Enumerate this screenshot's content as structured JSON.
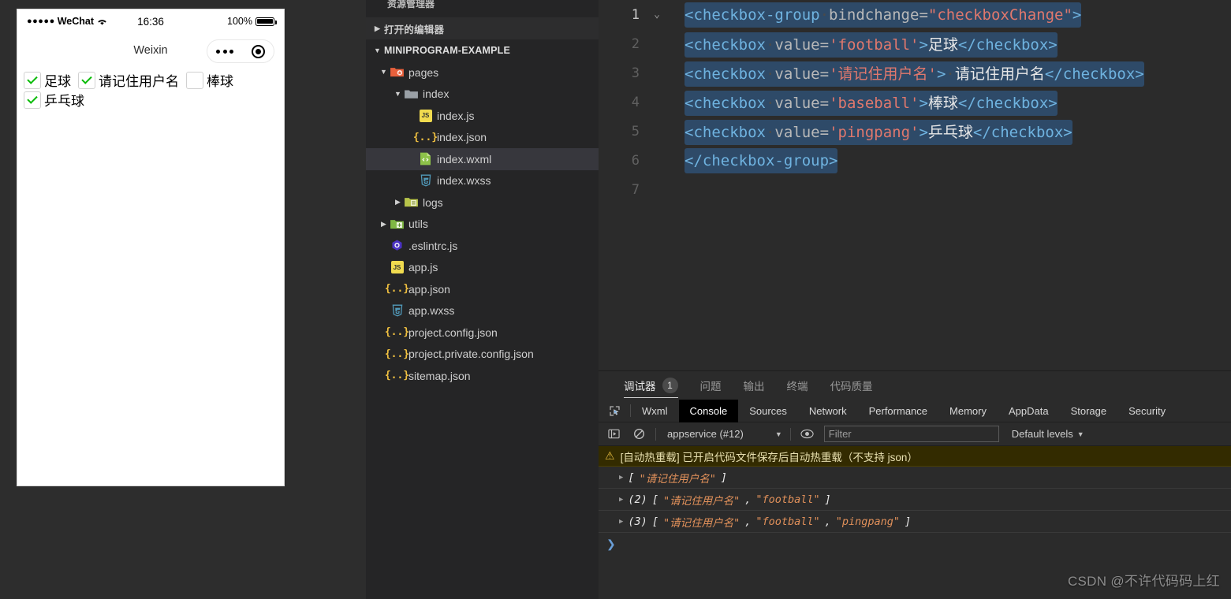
{
  "simulator": {
    "statusbar": {
      "carrier": "WeChat",
      "dots": "●●●●●",
      "wifi": "≈",
      "time": "16:36",
      "battery": "100%"
    },
    "navbar": {
      "title": "Weixin"
    },
    "checkboxes": [
      {
        "label": "足球",
        "checked": true
      },
      {
        "label": "请记住用户名",
        "checked": true
      },
      {
        "label": "棒球",
        "checked": false
      },
      {
        "label": "乒乓球",
        "checked": true
      }
    ]
  },
  "explorer": {
    "title": "资源管理器",
    "opened_editors": "打开的编辑器",
    "project": "MINIPROGRAM-EXAMPLE",
    "tree": [
      {
        "label": "pages",
        "type": "folder-pages",
        "depth": 1,
        "twisty": "▼"
      },
      {
        "label": "index",
        "type": "folder",
        "depth": 2,
        "twisty": "▼"
      },
      {
        "label": "index.js",
        "type": "js",
        "depth": 3,
        "twisty": ""
      },
      {
        "label": "index.json",
        "type": "json",
        "depth": 3,
        "twisty": ""
      },
      {
        "label": "index.wxml",
        "type": "wxml",
        "depth": 3,
        "twisty": "",
        "selected": true
      },
      {
        "label": "index.wxss",
        "type": "wxss",
        "depth": 3,
        "twisty": ""
      },
      {
        "label": "logs",
        "type": "folder-logs",
        "depth": 2,
        "twisty": "▶"
      },
      {
        "label": "utils",
        "type": "folder-utils",
        "depth": 1,
        "twisty": "▶"
      },
      {
        "label": ".eslintrc.js",
        "type": "eslint",
        "depth": 1,
        "twisty": ""
      },
      {
        "label": "app.js",
        "type": "js",
        "depth": 1,
        "twisty": ""
      },
      {
        "label": "app.json",
        "type": "json",
        "depth": 1,
        "twisty": ""
      },
      {
        "label": "app.wxss",
        "type": "wxss",
        "depth": 1,
        "twisty": ""
      },
      {
        "label": "project.config.json",
        "type": "json",
        "depth": 1,
        "twisty": ""
      },
      {
        "label": "project.private.config.json",
        "type": "json",
        "depth": 1,
        "twisty": ""
      },
      {
        "label": "sitemap.json",
        "type": "json",
        "depth": 1,
        "twisty": ""
      }
    ]
  },
  "editor": {
    "lines": [
      {
        "num": "1",
        "fold": "⌄",
        "active": true,
        "tokens": [
          {
            "t": "tag",
            "v": "<checkbox-group"
          },
          {
            "t": "dot",
            "v": "·"
          },
          {
            "t": "attr",
            "v": "bindchange"
          },
          {
            "t": "eq",
            "v": "="
          },
          {
            "t": "str",
            "v": "\"checkboxChange\""
          },
          {
            "t": "tag",
            "v": ">"
          }
        ]
      },
      {
        "num": "2",
        "fold": "",
        "tokens": [
          {
            "t": "tag",
            "v": "<checkbox"
          },
          {
            "t": "dot",
            "v": "·"
          },
          {
            "t": "attr",
            "v": "value"
          },
          {
            "t": "eq",
            "v": "="
          },
          {
            "t": "str",
            "v": "'football'"
          },
          {
            "t": "tag",
            "v": ">"
          },
          {
            "t": "txt",
            "v": "足球"
          },
          {
            "t": "tag",
            "v": "</checkbox>"
          }
        ]
      },
      {
        "num": "3",
        "fold": "",
        "tokens": [
          {
            "t": "tag",
            "v": "<checkbox"
          },
          {
            "t": "dot",
            "v": "·"
          },
          {
            "t": "attr",
            "v": "value"
          },
          {
            "t": "eq",
            "v": "="
          },
          {
            "t": "str",
            "v": "'请记住用户名'"
          },
          {
            "t": "tag",
            "v": ">"
          },
          {
            "t": "dot",
            "v": "·"
          },
          {
            "t": "txt",
            "v": "请记住用户名"
          },
          {
            "t": "tag",
            "v": "</checkbox>"
          }
        ]
      },
      {
        "num": "4",
        "fold": "",
        "tokens": [
          {
            "t": "tag",
            "v": "<checkbox"
          },
          {
            "t": "dot",
            "v": "·"
          },
          {
            "t": "attr",
            "v": "value"
          },
          {
            "t": "eq",
            "v": "="
          },
          {
            "t": "str",
            "v": "'baseball'"
          },
          {
            "t": "tag",
            "v": ">"
          },
          {
            "t": "txt",
            "v": "棒球"
          },
          {
            "t": "tag",
            "v": "</checkbox>"
          }
        ]
      },
      {
        "num": "5",
        "fold": "",
        "tokens": [
          {
            "t": "tag",
            "v": "<checkbox"
          },
          {
            "t": "dot",
            "v": "·"
          },
          {
            "t": "attr",
            "v": "value"
          },
          {
            "t": "eq",
            "v": "="
          },
          {
            "t": "str",
            "v": "'pingpang'"
          },
          {
            "t": "tag",
            "v": ">"
          },
          {
            "t": "txt",
            "v": "乒乓球"
          },
          {
            "t": "tag",
            "v": "</checkbox>"
          }
        ]
      },
      {
        "num": "6",
        "fold": "",
        "tokens": [
          {
            "t": "tag",
            "v": "</checkbox-group>"
          }
        ]
      },
      {
        "num": "7",
        "fold": "",
        "tokens": []
      }
    ]
  },
  "devpanel": {
    "tabs": [
      {
        "label": "调试器",
        "badge": "1",
        "active": true
      },
      {
        "label": "问题",
        "badge": "",
        "active": false
      },
      {
        "label": "输出",
        "badge": "",
        "active": false
      },
      {
        "label": "终端",
        "badge": "",
        "active": false
      },
      {
        "label": "代码质量",
        "badge": "",
        "active": false
      }
    ],
    "devtools_tabs": [
      {
        "label": "Wxml",
        "active": false
      },
      {
        "label": "Console",
        "active": true
      },
      {
        "label": "Sources",
        "active": false
      },
      {
        "label": "Network",
        "active": false
      },
      {
        "label": "Performance",
        "active": false
      },
      {
        "label": "Memory",
        "active": false
      },
      {
        "label": "AppData",
        "active": false
      },
      {
        "label": "Storage",
        "active": false
      },
      {
        "label": "Security",
        "active": false
      }
    ],
    "console_toolbar": {
      "context": "appservice (#12)",
      "filter_placeholder": "Filter",
      "levels": "Default levels"
    },
    "warning": "[自动热重载] 已开启代码文件保存后自动热重载（不支持 json）",
    "logs": [
      {
        "count": "",
        "items": [
          "\"请记住用户名\""
        ]
      },
      {
        "count": "(2)",
        "items": [
          "\"请记住用户名\"",
          "\"football\""
        ]
      },
      {
        "count": "(3)",
        "items": [
          "\"请记住用户名\"",
          "\"football\"",
          "\"pingpang\""
        ]
      }
    ],
    "prompt": "❯"
  },
  "watermark": "CSDN @不许代码码上红"
}
